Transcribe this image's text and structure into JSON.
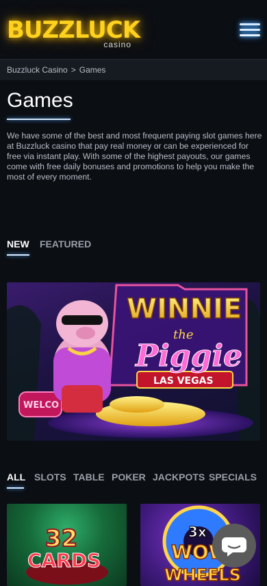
{
  "header": {
    "logo_text": "BUZZLUCK",
    "logo_sub": "casino",
    "menu_icon": "hamburger-menu-icon"
  },
  "breadcrumb": {
    "home": "Buzzluck Casino",
    "separator": ">",
    "current": "Games"
  },
  "page": {
    "title": "Games",
    "intro": "We have some of the best and most frequent paying slot games here at Buzzluck casino that pay real money or can be experienced for free via instant play. With some of the highest payouts, our games come with free daily bonuses and promotions to help you make the most of every moment."
  },
  "feature_tabs": {
    "new": "NEW",
    "featured": "FEATURED"
  },
  "banner": {
    "title_line1": "WINNIE",
    "title_the": "the",
    "title_line2": "Piggie",
    "subtitle": "LAS VEGAS",
    "sign_text": "WELCO"
  },
  "category_tabs": {
    "all": "ALL",
    "slots": "SLOTS",
    "table": "TABLE",
    "poker": "POKER",
    "jackpots": "JACKPOTS",
    "specials": "SPECIALS"
  },
  "games": [
    {
      "line1": "32",
      "line2": "CARDS"
    },
    {
      "line1": "3x",
      "line2": "WOW",
      "line3": "WHEELS"
    }
  ],
  "colors": {
    "background": "#0b0e13",
    "logo_yellow": "#ffd21f",
    "glow_blue": "#4aa3ff",
    "chat_button": "#5b5b5b"
  },
  "chat": {
    "icon": "chat-bubble-icon"
  }
}
